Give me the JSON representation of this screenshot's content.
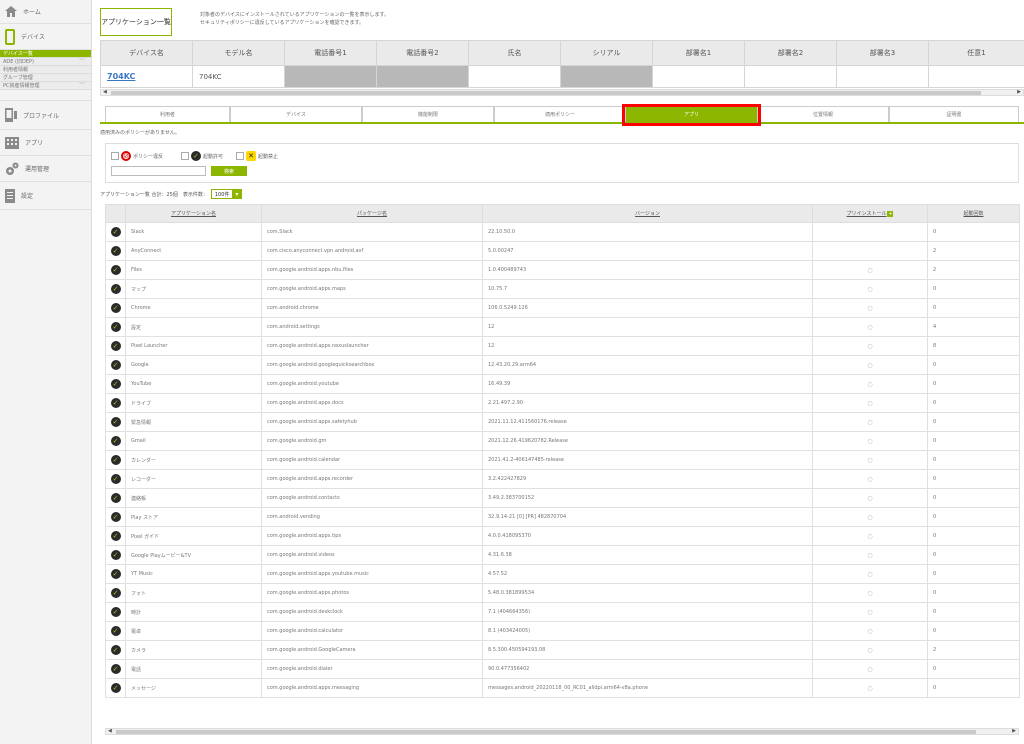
{
  "sidebar": {
    "home": "ホーム",
    "device": "デバイス",
    "subitems": [
      {
        "label": "デバイス一覧",
        "chev": ""
      },
      {
        "label": "ADE (旧DEP)",
        "chev": "﹀"
      },
      {
        "label": "利用者情報",
        "chev": ""
      },
      {
        "label": "グループ管理",
        "chev": ""
      },
      {
        "label": "PC資産情報管理",
        "chev": "﹀"
      }
    ],
    "profile": "プロファイル",
    "app": "アプリ",
    "ops": "運用管理",
    "settings": "設定"
  },
  "header": {
    "title": "アプリケーション一覧",
    "desc1": "対象者のデバイスにインストールされているアプリケーションの一覧を表示します。",
    "desc2": "セキュリティポリシーに違反しているアプリケーションを確認できます。"
  },
  "device_table": {
    "headers": [
      "デバイス名",
      "モデル名",
      "電話番号1",
      "電話番号2",
      "氏名",
      "シリアル",
      "部署名1",
      "部署名2",
      "部署名3",
      "任意1"
    ],
    "row": {
      "device": "704KC",
      "model": "704KC"
    }
  },
  "tabs": [
    "利用者",
    "デバイス",
    "機能制限",
    "適用ポリシー",
    "アプリ",
    "位置情報",
    "証明書"
  ],
  "active_tab": "アプリ",
  "policy_none": "適用済みのポリシーがありません。",
  "filter": {
    "violation": "ポリシー違反",
    "allowed": "起動許可",
    "banned": "起動禁止",
    "search_button": "検索",
    "search_placeholder": ""
  },
  "list_info": {
    "label": "アプリケーション一覧 合計：25個　表示件数：",
    "per_page": "100件"
  },
  "app_table": {
    "headers": [
      "アプリケーション名",
      "パッケージ名",
      "バージョン",
      "プリインストール",
      "起動回数"
    ],
    "rows": [
      {
        "name": "Slack",
        "pkg": "com.Slack",
        "ver": "22.10.50.0",
        "pre": "",
        "count": "0"
      },
      {
        "name": "AnyConnect",
        "pkg": "com.cisco.anyconnect.vpn.android.avf",
        "ver": "5.0.00247",
        "pre": "",
        "count": "2"
      },
      {
        "name": "Files",
        "pkg": "com.google.android.apps.nbu.files",
        "ver": "1.0.400489743",
        "pre": "○",
        "count": "2"
      },
      {
        "name": "マップ",
        "pkg": "com.google.android.apps.maps",
        "ver": "10.75.7",
        "pre": "○",
        "count": "0"
      },
      {
        "name": "Chrome",
        "pkg": "com.android.chrome",
        "ver": "106.0.5249.126",
        "pre": "○",
        "count": "0"
      },
      {
        "name": "設定",
        "pkg": "com.android.settings",
        "ver": "12",
        "pre": "○",
        "count": "4"
      },
      {
        "name": "Pixel Launcher",
        "pkg": "com.google.android.apps.nexuslauncher",
        "ver": "12",
        "pre": "○",
        "count": "8"
      },
      {
        "name": "Google",
        "pkg": "com.google.android.googlequicksearchbox",
        "ver": "12.43.20.29.arm64",
        "pre": "○",
        "count": "0"
      },
      {
        "name": "YouTube",
        "pkg": "com.google.android.youtube",
        "ver": "16.49.39",
        "pre": "○",
        "count": "0"
      },
      {
        "name": "ドライブ",
        "pkg": "com.google.android.apps.docs",
        "ver": "2.21.497.2.90",
        "pre": "○",
        "count": "0"
      },
      {
        "name": "緊急情報",
        "pkg": "com.google.android.apps.safetyhub",
        "ver": "2021.11.12.411560176.release",
        "pre": "○",
        "count": "0"
      },
      {
        "name": "Gmail",
        "pkg": "com.google.android.gm",
        "ver": "2021.12.26.419620782.Release",
        "pre": "○",
        "count": "0"
      },
      {
        "name": "カレンダー",
        "pkg": "com.google.android.calendar",
        "ver": "2021.41.2-406147485-release",
        "pre": "○",
        "count": "0"
      },
      {
        "name": "レコーダー",
        "pkg": "com.google.android.apps.recorder",
        "ver": "3.2.422427829",
        "pre": "○",
        "count": "0"
      },
      {
        "name": "連絡帳",
        "pkg": "com.google.android.contacts",
        "ver": "3.49.2.383700152",
        "pre": "○",
        "count": "0"
      },
      {
        "name": "Play ストア",
        "pkg": "com.android.vending",
        "ver": "32.9.14-21 [0] [PR] 482870704",
        "pre": "○",
        "count": "0"
      },
      {
        "name": "Pixel ガイド",
        "pkg": "com.google.android.apps.tips",
        "ver": "4.0.0.418095370",
        "pre": "○",
        "count": "0"
      },
      {
        "name": "Google Playムービー&TV",
        "pkg": "com.google.android.videos",
        "ver": "4.31.6.38",
        "pre": "○",
        "count": "0"
      },
      {
        "name": "YT Music",
        "pkg": "com.google.android.apps.youtube.music",
        "ver": "4.57.52",
        "pre": "○",
        "count": "0"
      },
      {
        "name": "フォト",
        "pkg": "com.google.android.apps.photos",
        "ver": "5.48.0.381899534",
        "pre": "○",
        "count": "0"
      },
      {
        "name": "時計",
        "pkg": "com.google.android.deskclock",
        "ver": "7.1 (404664356)",
        "pre": "○",
        "count": "0"
      },
      {
        "name": "電卓",
        "pkg": "com.google.android.calculator",
        "ver": "8.1 (403424005)",
        "pre": "○",
        "count": "0"
      },
      {
        "name": "カメラ",
        "pkg": "com.google.android.GoogleCamera",
        "ver": "8.5.300.450594193.08",
        "pre": "○",
        "count": "2"
      },
      {
        "name": "電話",
        "pkg": "com.google.android.dialer",
        "ver": "90.0.477356402",
        "pre": "○",
        "count": "0"
      },
      {
        "name": "メッセージ",
        "pkg": "com.google.android.apps.messaging",
        "ver": "messages.android_20220118_00_RC01_alldpi.arm64-v8a.phone",
        "pre": "○",
        "count": "0"
      }
    ]
  },
  "colors": {
    "accent": "#8db600",
    "highlight": "#ff0000"
  }
}
